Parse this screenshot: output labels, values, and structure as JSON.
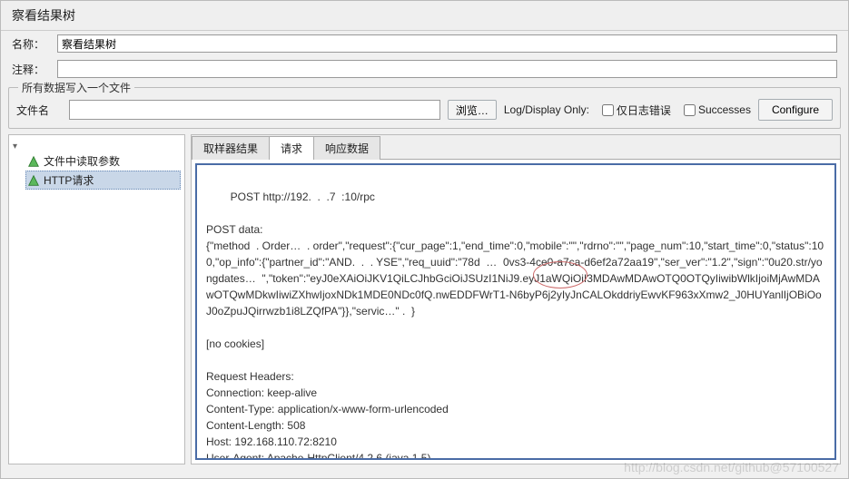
{
  "title": "察看结果树",
  "labels": {
    "name": "名称：",
    "comment": "注释：",
    "file_legend": "所有数据写入一个文件",
    "filename": "文件名",
    "browse": "浏览…",
    "log_display": "Log/Display Only:",
    "errors_only": "仅日志错误",
    "successes": "Successes",
    "configure": "Configure"
  },
  "name_value": "察看结果树",
  "comment_value": "",
  "filename_value": "",
  "tree": {
    "items": [
      {
        "label": "文件中读取参数",
        "selected": false
      },
      {
        "label": "HTTP请求",
        "selected": true
      }
    ]
  },
  "tabs": {
    "items": [
      {
        "label": "取样器结果",
        "active": false
      },
      {
        "label": "请求",
        "active": true
      },
      {
        "label": "响应数据",
        "active": false
      }
    ]
  },
  "request_body": "POST http://192.  .  .7  :10/rpc\n\nPOST data:\n{\"method  . Order…  . order\",\"request\":{\"cur_page\":1,\"end_time\":0,\"mobile\":\"\",\"rdrno\":\"\",\"page_num\":10,\"start_time\":0,\"status\":100,\"op_info\":{\"partner_id\":\"AND.  .  . YSE\",\"req_uuid\":\"78d  …  0vs3-4ce0-a7ca-d6ef2a72aa19\",\"ser_ver\":\"1.2\",\"sign\":\"0u20.str/yongdates…  \",\"token\":\"eyJ0eXAiOiJKV1QiLCJhbGciOiJSUzI1NiJ9.eyJ1aWQiOiI3MDAwMDAwOTQ0OTQyIiwibWlkIjoiMjAwMDAwOTQwMDkwIiwiZXhwIjoxNDk1MDE0NDc0fQ.nwEDDFWrT1-N6byP6j2yIyJnCALOkddriyEwvKF963xXmw2_J0HUYanlIjOBiOoJ0oZpuJQirrwzb1i8LZQfPA\"}},\"servic…\" .  }\n\n[no cookies]\n\nRequest Headers:\nConnection: keep-alive\nContent-Type: application/x-www-form-urlencoded\nContent-Length: 508\nHost: 192.168.110.72:8210\nUser-Agent: Apache-HttpClient/4.2.6 (java 1.5)",
  "watermark": "http://blog.csdn.net/github@57100527"
}
